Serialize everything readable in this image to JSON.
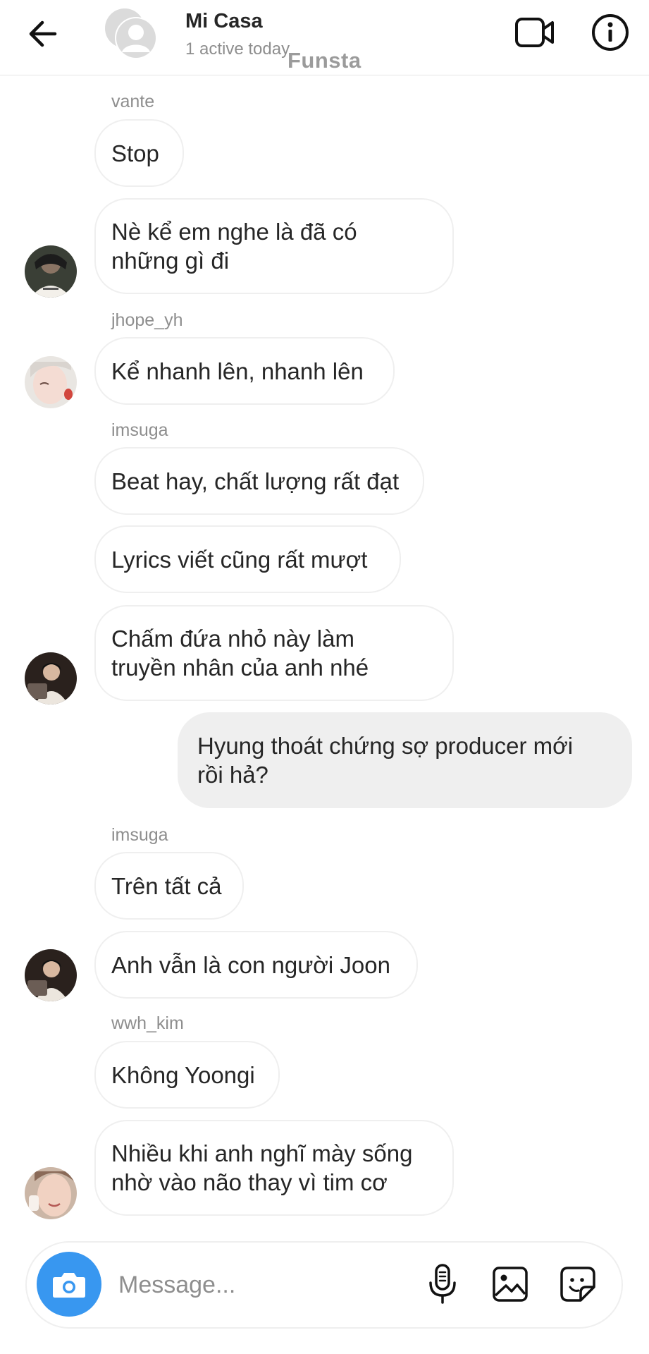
{
  "header": {
    "title": "Mi Casa",
    "status": "1 active today",
    "watermark": "Funsta"
  },
  "messages": [
    {
      "sender": "vante",
      "text": "Stop"
    },
    {
      "text": "Nè kể em nghe là đã có\nnhững gì đi"
    },
    {
      "sender": "jhope_yh",
      "text": "Kể nhanh lên, nhanh lên"
    },
    {
      "sender": "imsuga",
      "text": "Beat hay, chất lượng rất đạt"
    },
    {
      "text": "Lyrics viết cũng rất mượt"
    },
    {
      "text": "Chấm đứa nhỏ này làm\ntruyền nhân của anh nhé"
    },
    {
      "text": "Hyung thoát chứng sợ producer mới\nrồi hả?",
      "mine": true
    },
    {
      "sender": "imsuga",
      "text": "Trên tất cả"
    },
    {
      "text": "Anh vẫn là con người Joon"
    },
    {
      "sender": "wwh_kim",
      "text": "Không Yoongi"
    },
    {
      "text": "Nhiều khi anh nghĩ mày sống\nnhờ vào não thay vì tim cơ"
    }
  ],
  "composer": {
    "placeholder": "Message..."
  },
  "icons": {
    "back": "arrow-left-icon",
    "video": "video-camera-icon",
    "info": "info-icon",
    "camera": "camera-icon",
    "mic": "microphone-icon",
    "gallery": "image-icon",
    "sticker": "sticker-icon"
  },
  "colors": {
    "accent": "#3897f0",
    "my_bubble": "#efefef",
    "secondary_text": "#8e8e8e"
  }
}
